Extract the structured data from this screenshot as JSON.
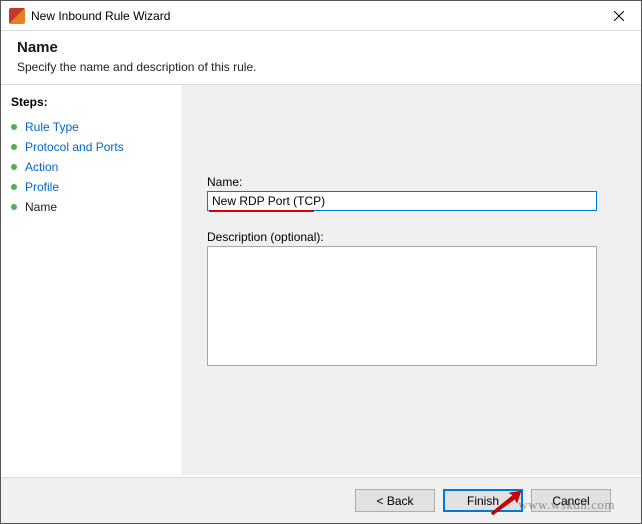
{
  "titlebar": {
    "title": "New Inbound Rule Wizard"
  },
  "header": {
    "title": "Name",
    "subtitle": "Specify the name and description of this rule."
  },
  "sidebar": {
    "heading": "Steps:",
    "items": [
      {
        "label": "Rule Type",
        "current": false
      },
      {
        "label": "Protocol and Ports",
        "current": false
      },
      {
        "label": "Action",
        "current": false
      },
      {
        "label": "Profile",
        "current": false
      },
      {
        "label": "Name",
        "current": true
      }
    ]
  },
  "form": {
    "name_label": "Name:",
    "name_value": "New RDP Port (TCP)",
    "desc_label": "Description (optional):",
    "desc_value": ""
  },
  "buttons": {
    "back": "< Back",
    "finish": "Finish",
    "cancel": "Cancel"
  },
  "watermark": "www.wskdn.com"
}
